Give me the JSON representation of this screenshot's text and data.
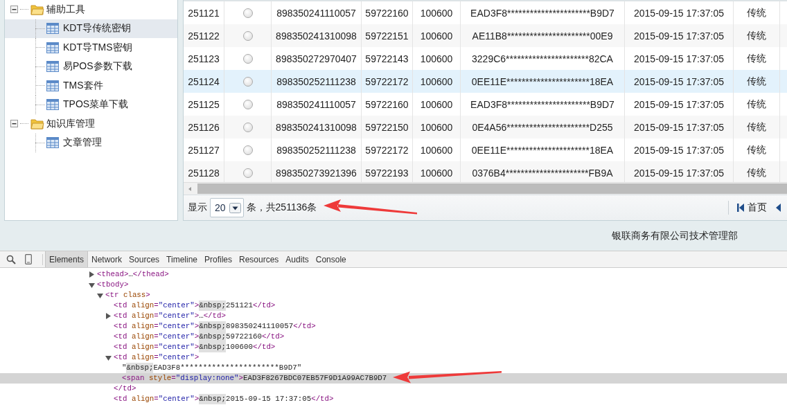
{
  "tree": [
    {
      "label": "辅助工具",
      "kind": "folder",
      "expanded": true,
      "selected": false,
      "children": [
        {
          "label": "KDT导传统密钥",
          "kind": "page",
          "selected": true
        },
        {
          "label": "KDT导TMS密钥",
          "kind": "page",
          "selected": false
        },
        {
          "label": "易POS参数下载",
          "kind": "page",
          "selected": false
        },
        {
          "label": "TMS套件",
          "kind": "page",
          "selected": false
        },
        {
          "label": "TPOS菜单下载",
          "kind": "page",
          "selected": false
        }
      ]
    },
    {
      "label": "知识库管理",
      "kind": "folder",
      "expanded": true,
      "selected": false,
      "children": [
        {
          "label": "文章管理",
          "kind": "page",
          "selected": false
        }
      ]
    }
  ],
  "table": {
    "rows": [
      {
        "selected": false,
        "checked": false,
        "cells": [
          "251121",
          "898350241110057",
          "59722160",
          "100600",
          "EAD3F8**********************B9D7",
          "2015-09-15 17:37:05",
          "传统"
        ]
      },
      {
        "selected": false,
        "checked": false,
        "cells": [
          "251122",
          "898350241310098",
          "59722151",
          "100600",
          "AE11B8**********************00E9",
          "2015-09-15 17:37:05",
          "传统"
        ]
      },
      {
        "selected": false,
        "checked": false,
        "cells": [
          "251123",
          "898350272970407",
          "59722143",
          "100600",
          "3229C6**********************82CA",
          "2015-09-15 17:37:05",
          "传统"
        ]
      },
      {
        "selected": true,
        "checked": false,
        "cells": [
          "251124",
          "898350252111238",
          "59722172",
          "100600",
          "0EE11E**********************18EA",
          "2015-09-15 17:37:05",
          "传统"
        ]
      },
      {
        "selected": false,
        "checked": false,
        "cells": [
          "251125",
          "898350241110057",
          "59722160",
          "100600",
          "EAD3F8**********************B9D7",
          "2015-09-15 17:37:05",
          "传统"
        ]
      },
      {
        "selected": false,
        "checked": false,
        "cells": [
          "251126",
          "898350241310098",
          "59722150",
          "100600",
          "0E4A56**********************D255",
          "2015-09-15 17:37:05",
          "传统"
        ]
      },
      {
        "selected": false,
        "checked": false,
        "cells": [
          "251127",
          "898350252111238",
          "59722172",
          "100600",
          "0EE11E**********************18EA",
          "2015-09-15 17:37:05",
          "传统"
        ]
      },
      {
        "selected": false,
        "checked": false,
        "cells": [
          "251128",
          "898350273921396",
          "59722193",
          "100600",
          "0376B4**********************FB9A",
          "2015-09-15 17:37:05",
          "传统"
        ]
      }
    ]
  },
  "pager": {
    "show_label": "显示",
    "page_size": "20",
    "total_label": "条，共251136条",
    "first_label": "首页"
  },
  "footer": "银联商务有限公司技术管理部",
  "devtools": {
    "tabs": [
      {
        "label": "Elements",
        "selected": true
      },
      {
        "label": "Network",
        "selected": false
      },
      {
        "label": "Sources",
        "selected": false
      },
      {
        "label": "Timeline",
        "selected": false
      },
      {
        "label": "Profiles",
        "selected": false
      },
      {
        "label": "Resources",
        "selected": false
      },
      {
        "label": "Audits",
        "selected": false
      },
      {
        "label": "Console",
        "selected": false
      }
    ],
    "dom": [
      {
        "text": "<thead>…</thead>",
        "expanded": false,
        "selected": false
      },
      {
        "text": "<tbody>",
        "expanded": true,
        "selected": false,
        "children": [
          {
            "text": "<tr class>",
            "expanded": true,
            "selected": false,
            "children": [
              {
                "text": "<td align=\"center\">&nbsp;251121</td>",
                "selected": false
              },
              {
                "text": "<td align=\"center\">…</td>",
                "expanded": false,
                "selected": false
              },
              {
                "text": "<td align=\"center\">&nbsp;898350241110057</td>",
                "selected": false
              },
              {
                "text": "<td align=\"center\">&nbsp;59722160</td>",
                "selected": false
              },
              {
                "text": "<td align=\"center\">&nbsp;100600</td>",
                "selected": false
              },
              {
                "text": "<td align=\"center\">",
                "expanded": true,
                "selected": false,
                "children": [
                  {
                    "text": "\"&nbsp;EAD3F8**********************B9D7\"",
                    "selected": false
                  },
                  {
                    "text": "<span style=\"display:none\">EAD3F8267BDC07EB57F9D1A99AC7B9D7",
                    "selected": true
                  }
                ]
              },
              {
                "text": "</td>",
                "selected": false
              },
              {
                "text": "<td align=\"center\">&nbsp;2015-09-15 17:37:05</td>",
                "selected": false
              }
            ]
          }
        ]
      }
    ]
  }
}
